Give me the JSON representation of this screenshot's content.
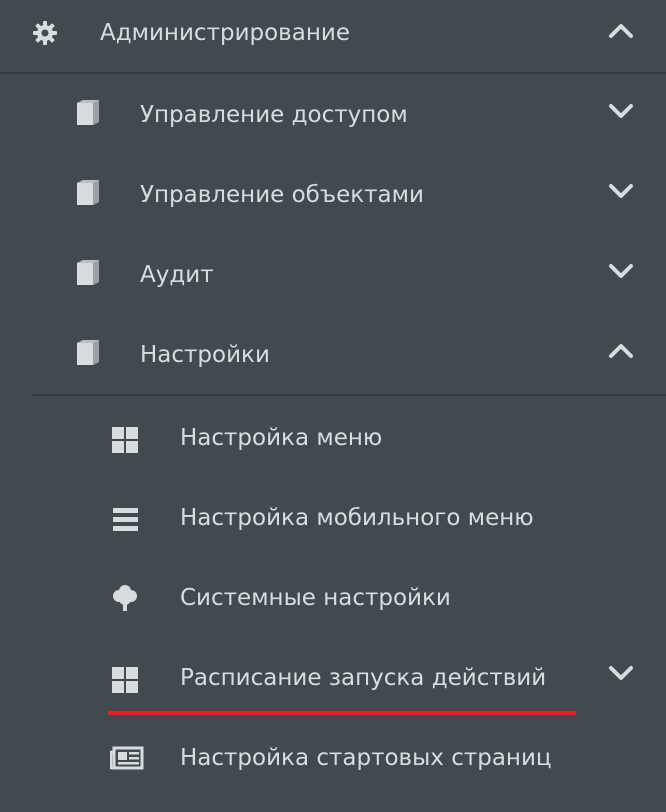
{
  "colors": {
    "background": "#424a50",
    "text": "#d7dcdf",
    "icon": "#d7dcdf",
    "divider": "#363c41",
    "highlight_underline": "#e0242c"
  },
  "section": {
    "label": "Администрирование",
    "icon": "gear-icon",
    "expanded": true
  },
  "groups": [
    {
      "label": "Управление доступом",
      "icon": "book-icon",
      "expanded": false
    },
    {
      "label": "Управление объектами",
      "icon": "book-icon",
      "expanded": false
    },
    {
      "label": "Аудит",
      "icon": "book-icon",
      "expanded": false
    },
    {
      "label": "Настройки",
      "icon": "book-icon",
      "expanded": true
    }
  ],
  "settings_items": [
    {
      "label": "Настройка меню",
      "icon": "grid-icon"
    },
    {
      "label": "Настройка мобильного меню",
      "icon": "list-icon"
    },
    {
      "label": "Системные настройки",
      "icon": "tree-icon"
    },
    {
      "label": "Расписание запуска действий",
      "icon": "grid-icon",
      "has_children": true,
      "highlighted": true
    },
    {
      "label": "Настройка стартовых страниц",
      "icon": "newspaper-icon"
    }
  ]
}
